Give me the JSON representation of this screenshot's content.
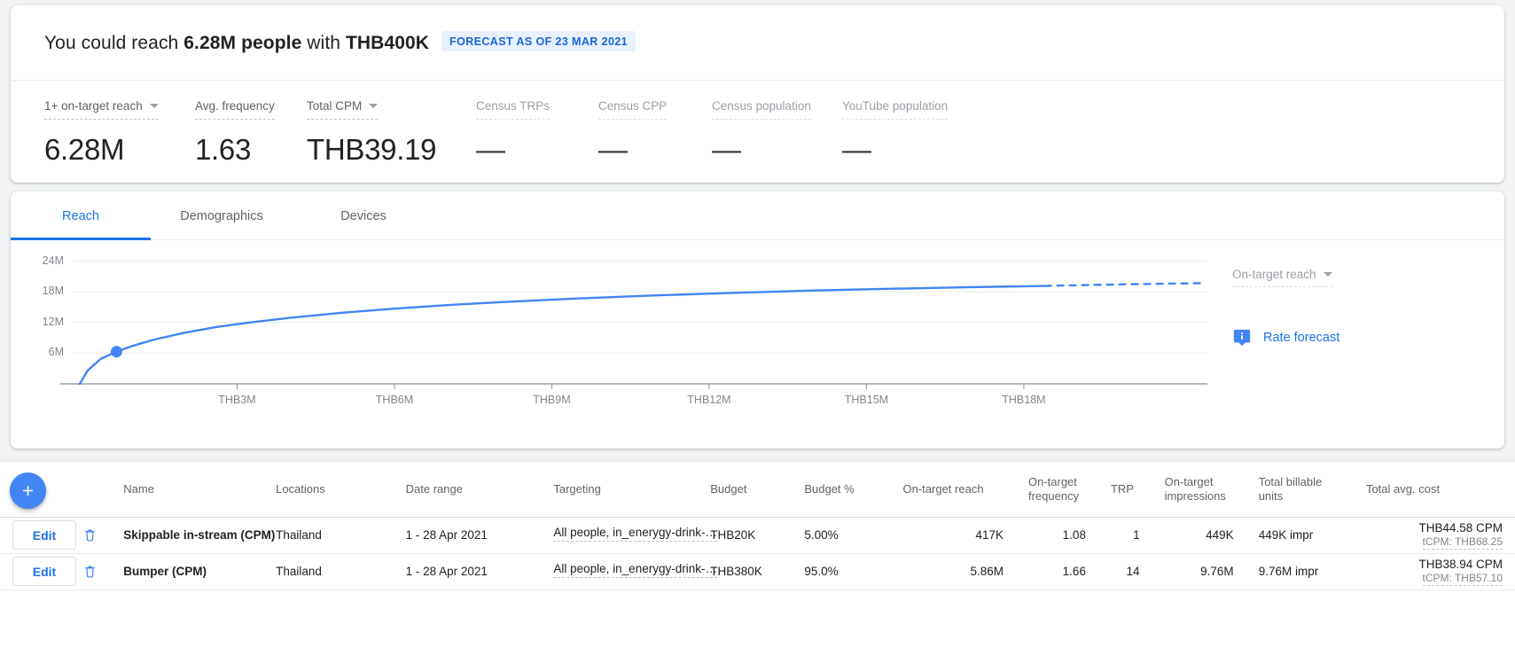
{
  "header": {
    "prefix": "You could reach ",
    "reach_value": "6.28M people",
    "middle": " with ",
    "budget_value": "THB400K",
    "badge": "FORECAST AS OF 23 MAR 2021"
  },
  "metrics": [
    {
      "label": "1+ on-target reach",
      "value": "6.28M",
      "has_caret": true,
      "dim": false
    },
    {
      "label": "Avg. frequency",
      "value": "1.63",
      "has_caret": false,
      "dim": false
    },
    {
      "label": "Total CPM",
      "value": "THB39.19",
      "has_caret": true,
      "dim": false
    },
    {
      "label": "Census TRPs",
      "value": "—",
      "has_caret": false,
      "dim": true
    },
    {
      "label": "Census CPP",
      "value": "—",
      "has_caret": false,
      "dim": true
    },
    {
      "label": "Census population",
      "value": "—",
      "has_caret": false,
      "dim": true
    },
    {
      "label": "YouTube population",
      "value": "—",
      "has_caret": false,
      "dim": true
    }
  ],
  "tabs": [
    {
      "label": "Reach",
      "active": true
    },
    {
      "label": "Demographics",
      "active": false
    },
    {
      "label": "Devices",
      "active": false
    }
  ],
  "chart_side": {
    "metric_select": "On-target reach",
    "rate_forecast": "Rate forecast"
  },
  "chart_data": {
    "type": "line",
    "title": "",
    "xlabel": "",
    "ylabel": "",
    "xtick_labels": [
      "THB3M",
      "THB6M",
      "THB9M",
      "THB12M",
      "THB15M",
      "THB18M"
    ],
    "xtick_values": [
      3000000,
      6000000,
      9000000,
      12000000,
      15000000,
      18000000
    ],
    "ytick_labels": [
      "6M",
      "12M",
      "18M",
      "24M"
    ],
    "ytick_values": [
      6000000,
      12000000,
      18000000,
      24000000
    ],
    "xlim": [
      0,
      21500000
    ],
    "ylim": [
      0,
      26000000
    ],
    "grid": true,
    "legend": "none",
    "series": [
      {
        "name": "On-target reach",
        "style": "solid",
        "color": "#4285f4",
        "x": [
          0,
          150000,
          400000,
          700000,
          1000000,
          1400000,
          2000000,
          2600000,
          3200000,
          4000000,
          5000000,
          6000000,
          7000000,
          8000000,
          9500000,
          11000000,
          12500000,
          14000000,
          15500000,
          17000000,
          18400000
        ],
        "y": [
          0,
          2600000,
          4900000,
          6280000,
          7400000,
          8600000,
          10000000,
          11100000,
          11950000,
          12900000,
          13900000,
          14700000,
          15400000,
          15950000,
          16700000,
          17300000,
          17800000,
          18250000,
          18600000,
          18900000,
          19150000
        ]
      },
      {
        "name": "On-target reach (extrapolated)",
        "style": "dashed",
        "color": "#4285f4",
        "x": [
          18400000,
          19200000,
          20000000,
          20800000,
          21400000
        ],
        "y": [
          19150000,
          19320000,
          19470000,
          19600000,
          19690000
        ]
      }
    ],
    "marker": {
      "x": 700000,
      "y": 6280000,
      "label": "6.28M",
      "color": "#4285f4"
    }
  },
  "fab": {
    "label": "+"
  },
  "table": {
    "columns": [
      {
        "key": "edit",
        "label": ""
      },
      {
        "key": "delete",
        "label": ""
      },
      {
        "key": "name",
        "label": "Name"
      },
      {
        "key": "locations",
        "label": "Locations"
      },
      {
        "key": "daterange",
        "label": "Date range"
      },
      {
        "key": "targeting",
        "label": "Targeting"
      },
      {
        "key": "budget",
        "label": "Budget"
      },
      {
        "key": "budgetpct",
        "label": "Budget %"
      },
      {
        "key": "reach",
        "label": "On-target reach"
      },
      {
        "key": "frequency",
        "label": "On-target frequency"
      },
      {
        "key": "trp",
        "label": "TRP"
      },
      {
        "key": "impressions",
        "label": "On-target impressions"
      },
      {
        "key": "units",
        "label": "Total billable units"
      },
      {
        "key": "cost",
        "label": "Total avg. cost"
      }
    ],
    "edit_label": "Edit",
    "rows": [
      {
        "name": "Skippable in-stream (CPM)",
        "locations": "Thailand",
        "daterange": "1 - 28 Apr 2021",
        "targeting": "All people, in_enerygy-drink-…",
        "budget": "THB20K",
        "budgetpct": "5.00%",
        "reach": "417K",
        "frequency": "1.08",
        "trp": "1",
        "impressions": "449K",
        "units": "449K impr",
        "cost_main": "THB44.58 CPM",
        "cost_sub": "tCPM: THB68.25"
      },
      {
        "name": "Bumper (CPM)",
        "locations": "Thailand",
        "daterange": "1 - 28 Apr 2021",
        "targeting": "All people, in_enerygy-drink-…",
        "budget": "THB380K",
        "budgetpct": "95.0%",
        "reach": "5.86M",
        "frequency": "1.66",
        "trp": "14",
        "impressions": "9.76M",
        "units": "9.76M impr",
        "cost_main": "THB38.94 CPM",
        "cost_sub": "tCPM: THB57.10"
      }
    ]
  }
}
